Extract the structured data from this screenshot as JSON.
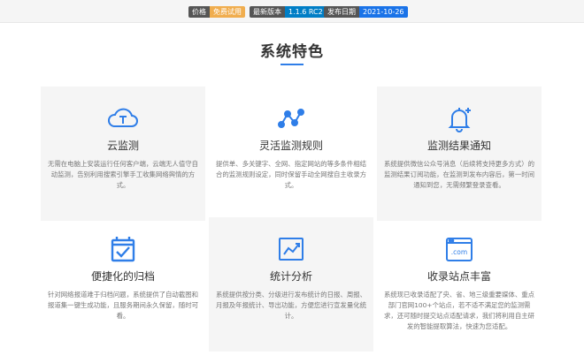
{
  "badges": [
    {
      "key": "价格",
      "value": "免费试用",
      "color": "#f0ad4e"
    },
    {
      "key": "最新版本",
      "value": "1.1.6 RC2",
      "color": "#007ec6"
    },
    {
      "key": "发布日期",
      "value": "2021-10-26",
      "color": "#1a73e8"
    }
  ],
  "section": {
    "title": "系统特色",
    "accent": "#2f7ee8"
  },
  "features": [
    {
      "icon": "cloud-icon",
      "title": "云监测",
      "desc": "无需在电脑上安装运行任何客户端，云端无人值守自动监测，告别利用搜索引擎手工收集网络舆情的方式。"
    },
    {
      "icon": "nodes-icon",
      "title": "灵活监测规则",
      "desc": "提供单、多关键字、全网、指定网站的等多条件相结合的监测规则设定，同时保留手动全网搜自主收录方式。"
    },
    {
      "icon": "bell-icon",
      "title": "监测结果通知",
      "desc": "系统提供微信公众号消息（后续将支持更多方式）的监测结果订阅功能，在监测到发布内容后，第一时间通知到您，无需频繁登录查看。"
    },
    {
      "icon": "archive-icon",
      "title": "便捷化的归档",
      "desc": "针对网络报道难于归档问题，系统提供了自动截图和报道集一键生成功能，且服务期间永久保留，随时可看。"
    },
    {
      "icon": "chart-icon",
      "title": "统计分析",
      "desc": "系统提供按分类、分级进行发布统计的日报、周报、月报及年报统计、导出功能，方便您进行宣发量化统计。"
    },
    {
      "icon": "web-icon",
      "title": "收录站点丰富",
      "icon_text": ".com",
      "desc": "系统现已收录适配了央、省、地三级重要媒体、重点部门官网100+个站点，若不适不满足您的监测需求，还可随时提交站点适配请求，我们将利用自主研发的智能提取算法，快速为您适配。"
    }
  ]
}
